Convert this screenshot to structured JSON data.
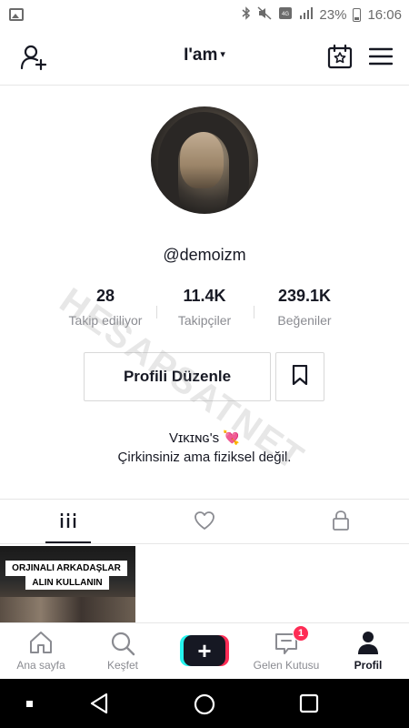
{
  "status_bar": {
    "battery_percent": "23%",
    "time": "16:06"
  },
  "top_nav": {
    "title": "I'am",
    "caret": "▾"
  },
  "profile": {
    "username": "@demoizm",
    "stats": [
      {
        "value": "28",
        "label": "Takip ediliyor"
      },
      {
        "value": "11.4K",
        "label": "Takipçiler"
      },
      {
        "value": "239.1K",
        "label": "Beğeniler"
      }
    ],
    "edit_button": "Profili Düzenle",
    "bio_line1": "Vɪᴋɪɴɢ's",
    "bio_heart": "💘",
    "bio_line2": "Çirkinsiniz ama fiziksel değil."
  },
  "video": {
    "caption_line1": "ORJINALI ARKADAŞLAR",
    "caption_line2": "ALIN KULLANIN"
  },
  "watermark": "HESAPSATNET",
  "bottom_nav": {
    "home": "Ana sayfa",
    "discover": "Keşfet",
    "create": "+",
    "inbox": "Gelen Kutusu",
    "inbox_badge": "1",
    "profile": "Profil"
  },
  "colors": {
    "accent_pink": "#fe2c55",
    "accent_cyan": "#25f4ee",
    "text_primary": "#161823",
    "text_secondary": "#8a8b91"
  }
}
